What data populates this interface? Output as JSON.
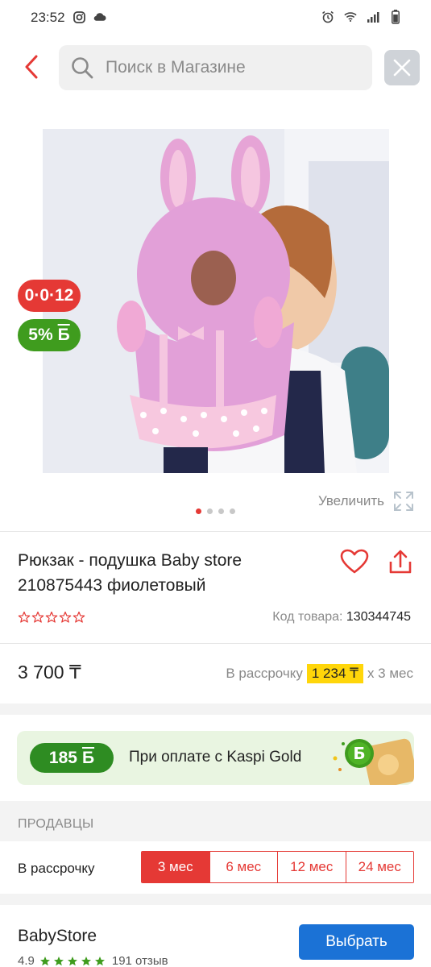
{
  "status_bar": {
    "time": "23:52",
    "left_icons": [
      "instagram-icon",
      "cloud-icon"
    ],
    "right_icons": [
      "alarm-icon",
      "wifi-icon",
      "signal-icon",
      "battery-icon"
    ]
  },
  "search": {
    "placeholder": "Поиск в Магазине",
    "back_icon": "chevron-left-icon",
    "close_icon": "close-icon"
  },
  "gallery": {
    "image_subject": "pink bunny head-protection pillow backpack worn by a toddler",
    "badges": {
      "installment": "0·0·12",
      "bonus": "5%",
      "bonus_currency": "Б"
    },
    "zoom_label": "Увеличить",
    "dots_count": 4,
    "active_dot": 0
  },
  "product": {
    "title": "Рюкзак - подушка Baby store 210875443 фиолетовый",
    "rating_stars": 0,
    "sku_label": "Код товара:",
    "sku_value": "130344745"
  },
  "price": {
    "value": "3 700 ₸",
    "installment_label": "В рассрочку",
    "installment_monthly": "1 234 ₸",
    "installment_term": "х 3 мес"
  },
  "kaspi_gold": {
    "bonus": "185",
    "bonus_currency": "Б",
    "text": "При оплате с Kaspi Gold"
  },
  "sellers": {
    "section_title": "ПРОДАВЦЫ",
    "installment_label": "В рассрочку",
    "terms": [
      "3 мес",
      "6 мес",
      "12 мес",
      "24 мес"
    ],
    "active_term": 0
  },
  "seller_card": {
    "name": "BabyStore",
    "rating": "4.9",
    "reviews": "191 отзыв",
    "choose_label": "Выбрать"
  },
  "colors": {
    "accent_red": "#e53935",
    "bonus_green": "#3f9c1e",
    "primary_blue": "#1b72d6",
    "highlight_yellow": "#ffd60a"
  }
}
